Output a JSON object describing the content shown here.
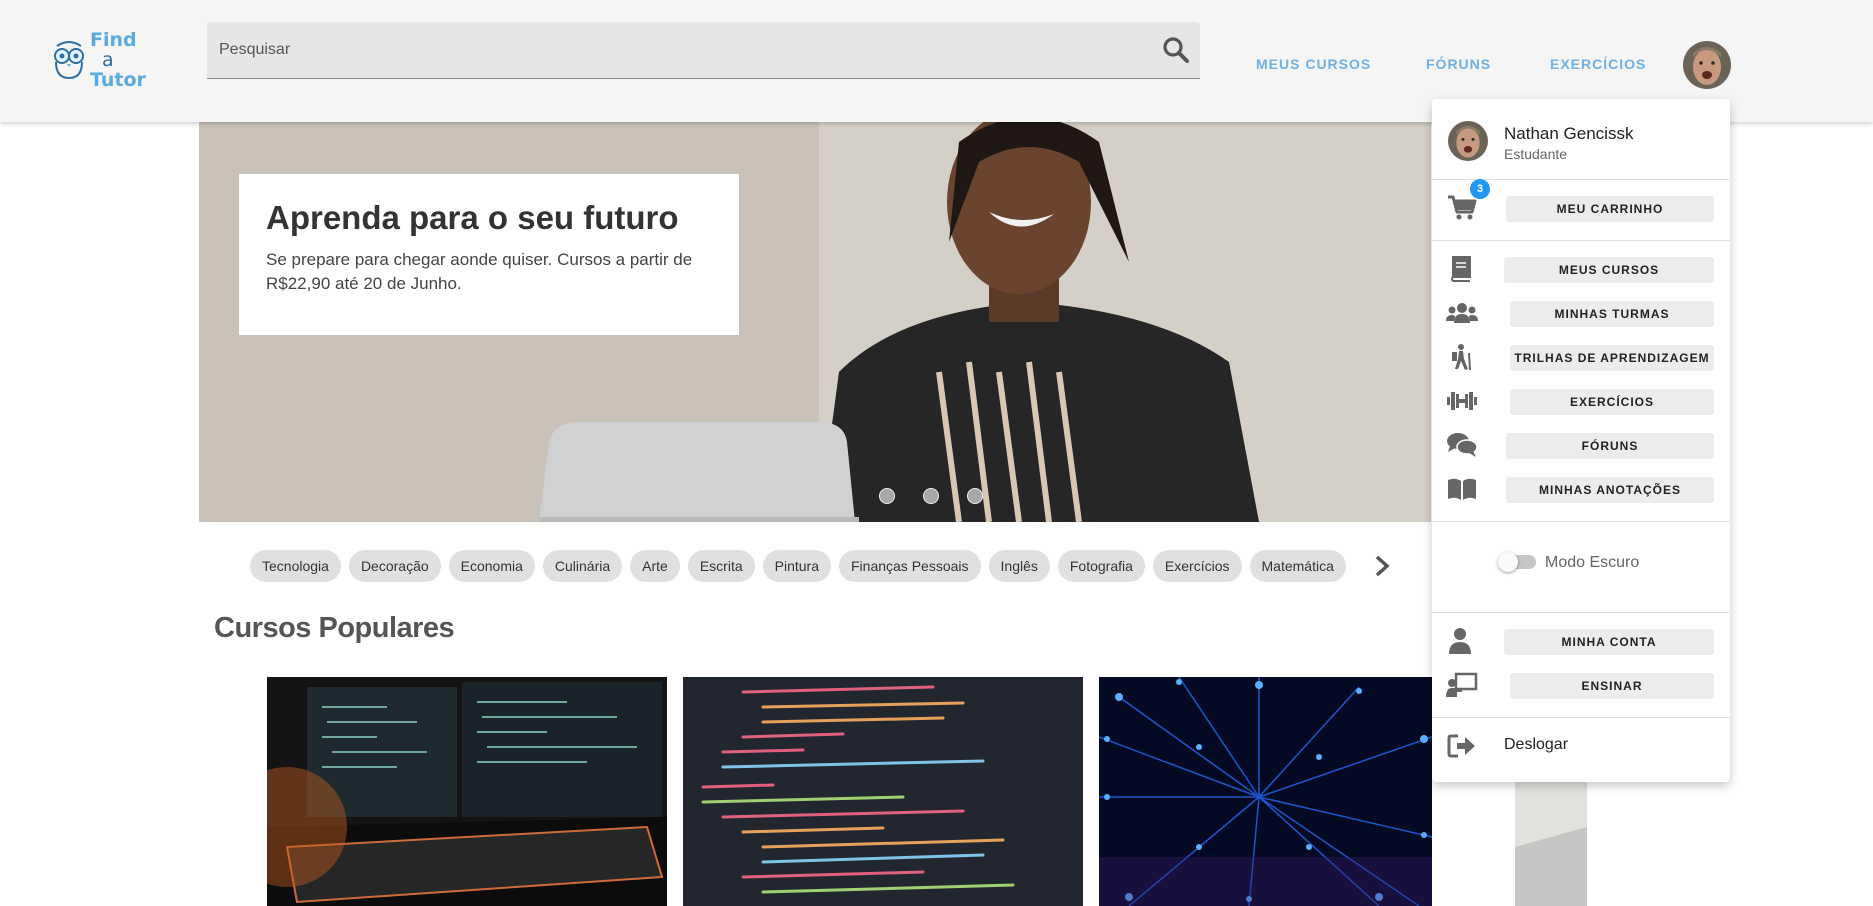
{
  "header": {
    "logo_words": [
      "Find",
      "a",
      "Tutor"
    ],
    "search_placeholder": "Pesquisar",
    "nav": [
      "MEUS CURSOS",
      "FÓRUNS",
      "EXERCÍCIOS"
    ]
  },
  "hero": {
    "title": "Aprenda para o seu futuro",
    "text": "Se prepare para chegar aonde quiser. Cursos a partir de R$22,90 até 20 de Junho.",
    "slides": 3
  },
  "categories": [
    "Tecnologia",
    "Decoração",
    "Economia",
    "Culinária",
    "Arte",
    "Escrita",
    "Pintura",
    "Finanças Pessoais",
    "Inglês",
    "Fotografia",
    "Exercícios",
    "Matemática"
  ],
  "section_title": "Cursos Populares",
  "user_menu": {
    "name": "Nathan Gencissk",
    "role": "Estudante",
    "cart_label": "MEU CARRINHO",
    "cart_count": "3",
    "items": [
      "MEUS CURSOS",
      "MINHAS TURMAS",
      "TRILHAS DE APRENDIZAGEM",
      "EXERCÍCIOS",
      "FÓRUNS",
      "MINHAS ANOTAÇÕES"
    ],
    "dark_mode_label": "Modo Escuro",
    "account_label": "MINHA CONTA",
    "teach_label": "ENSINAR",
    "logout_label": "Deslogar"
  },
  "icons": {
    "search": "search-icon",
    "cart": "cart-icon",
    "book": "book-icon",
    "group": "group-icon",
    "hiking": "hiking-icon",
    "dumbbell": "dumbbell-icon",
    "comments": "comments-icon",
    "open_book": "open-book-icon",
    "user": "user-icon",
    "teacher": "teacher-icon",
    "logout": "logout-icon"
  },
  "colors": {
    "accent": "#6fb0e6",
    "badge": "#2196f3",
    "icon_gray": "#666666"
  }
}
